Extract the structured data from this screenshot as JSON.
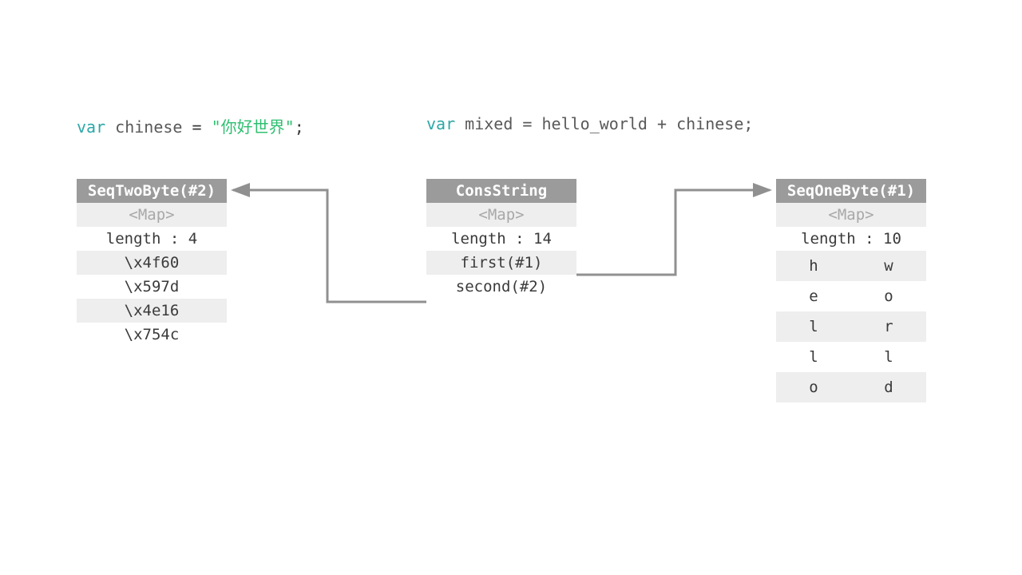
{
  "code": {
    "left": {
      "kw": "var",
      "ident": " chinese ",
      "eq": "= ",
      "str": "\"你好世界\"",
      "end": ";"
    },
    "right": {
      "kw": "var",
      "rest": " mixed = hello_world + chinese;"
    }
  },
  "boxes": {
    "left": {
      "header": "SeqTwoByte(#2)",
      "rows": [
        "<Map>",
        "length : 4",
        "\\x4f60",
        "\\x597d",
        "\\x4e16",
        "\\x754c"
      ]
    },
    "center": {
      "header": "ConsString",
      "rows": [
        "<Map>",
        "length : 14",
        "first(#1)",
        "second(#2)"
      ]
    },
    "right": {
      "header": "SeqOneByte(#1)",
      "map": "<Map>",
      "length": "length : 10",
      "col1": [
        "h",
        "e",
        "l",
        "l",
        "o"
      ],
      "col2": [
        "w",
        "o",
        "r",
        "l",
        "d"
      ]
    }
  }
}
